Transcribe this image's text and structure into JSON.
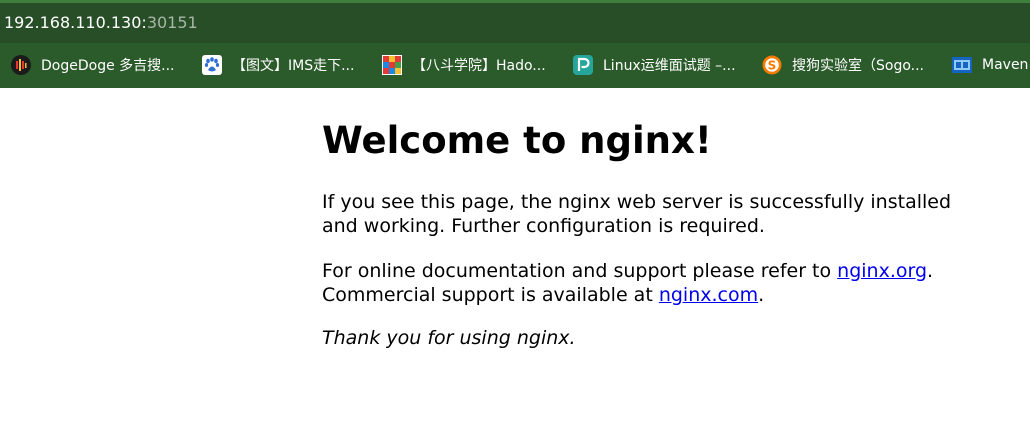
{
  "browser": {
    "url_host": "192.168.110.130:",
    "url_port": "30151",
    "colors": {
      "address_bar": "#274e27",
      "bookmarks_bar": "#2b5a2b",
      "top_line": "#3f7f3c"
    }
  },
  "bookmarks": [
    {
      "label": "DogeDoge 多吉搜...",
      "icon": "dogedoge-icon"
    },
    {
      "label": "【图文】IMS走下...",
      "icon": "baidu-paw-icon"
    },
    {
      "label": "【八斗学院】Hado...",
      "icon": "badou-icon"
    },
    {
      "label": "Linux运维面试题 –...",
      "icon": "p-logo-icon"
    },
    {
      "label": "搜狗实验室（Sogo...",
      "icon": "sogou-icon"
    },
    {
      "label": "Maven",
      "icon": "maven-icon"
    }
  ],
  "page": {
    "heading": "Welcome to nginx!",
    "para1": "If you see this page, the nginx web server is successfully installed and working. Further configuration is required.",
    "para2_prefix": "For online documentation and support please refer to ",
    "link1": "nginx.org",
    "para2_mid": ".",
    "para2_line2_prefix": "Commercial support is available at ",
    "link2": "nginx.com",
    "para2_suffix": ".",
    "para3": "Thank you for using nginx.",
    "link_color": "#0000ee"
  }
}
